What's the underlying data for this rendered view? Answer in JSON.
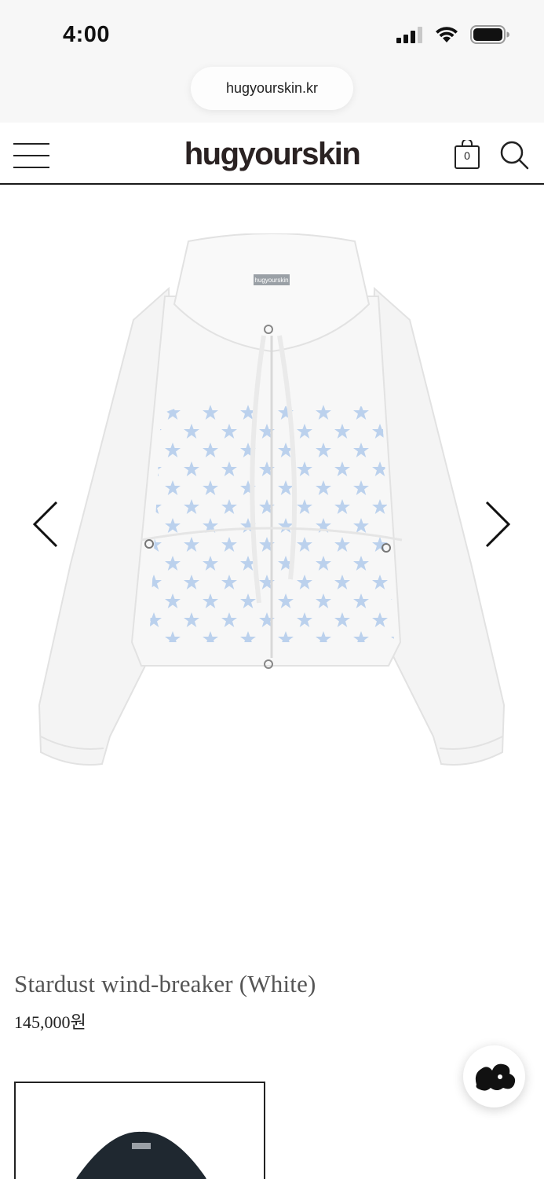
{
  "status_bar": {
    "time": "4:00",
    "icons": [
      "signal-icon",
      "wifi-icon",
      "battery-icon"
    ]
  },
  "browser": {
    "url": "hugyourskin.kr"
  },
  "header": {
    "logo": "hugyourskin",
    "cart_count": "0",
    "icons": [
      "menu-icon",
      "cart-icon",
      "search-icon"
    ]
  },
  "gallery": {
    "prev_icon": "chevron-left-icon",
    "next_icon": "chevron-right-icon",
    "garment_label": "hugyourskin"
  },
  "product": {
    "name": "Stardust wind-breaker (White)",
    "price": "145,000원"
  },
  "chat": {
    "icon": "chat-blob-icon"
  },
  "colors": {
    "accent_star": "#a9c6ea",
    "garment": "#f4f4f4",
    "text_dark": "#222222",
    "text_muted": "#555555"
  }
}
